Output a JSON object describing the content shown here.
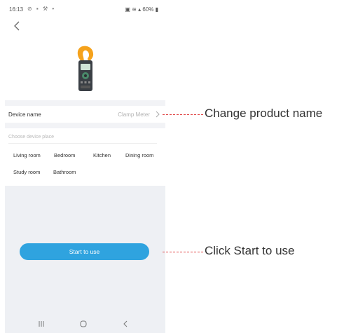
{
  "status_bar": {
    "time": "16:13",
    "left_icons": "⊘ ▪ ⚒ •",
    "right_icons": "▣ ≋ ▴ 60% ▮"
  },
  "icons": {
    "back": "chevron-left-icon",
    "device": "clamp-meter-icon",
    "row_chevron": "chevron-right-icon",
    "nav_recent": "recent-apps-icon",
    "nav_home": "home-icon",
    "nav_back": "back-icon"
  },
  "device_row": {
    "label": "Device name",
    "value": "Clamp Meter"
  },
  "place": {
    "header": "Choose device place",
    "rooms": [
      "Living room",
      "Bedroom",
      "Kitchen",
      "Dining room",
      "Study room",
      "Bathroom"
    ]
  },
  "start_button": {
    "label": "Start to use"
  },
  "annotations": {
    "change_name": "Change product name",
    "start_use": "Click Start to use"
  },
  "colors": {
    "accent": "#2fa3df",
    "leader": "#e04545",
    "meter_body": "#f5a21c",
    "background_gray": "#eef0f4"
  }
}
